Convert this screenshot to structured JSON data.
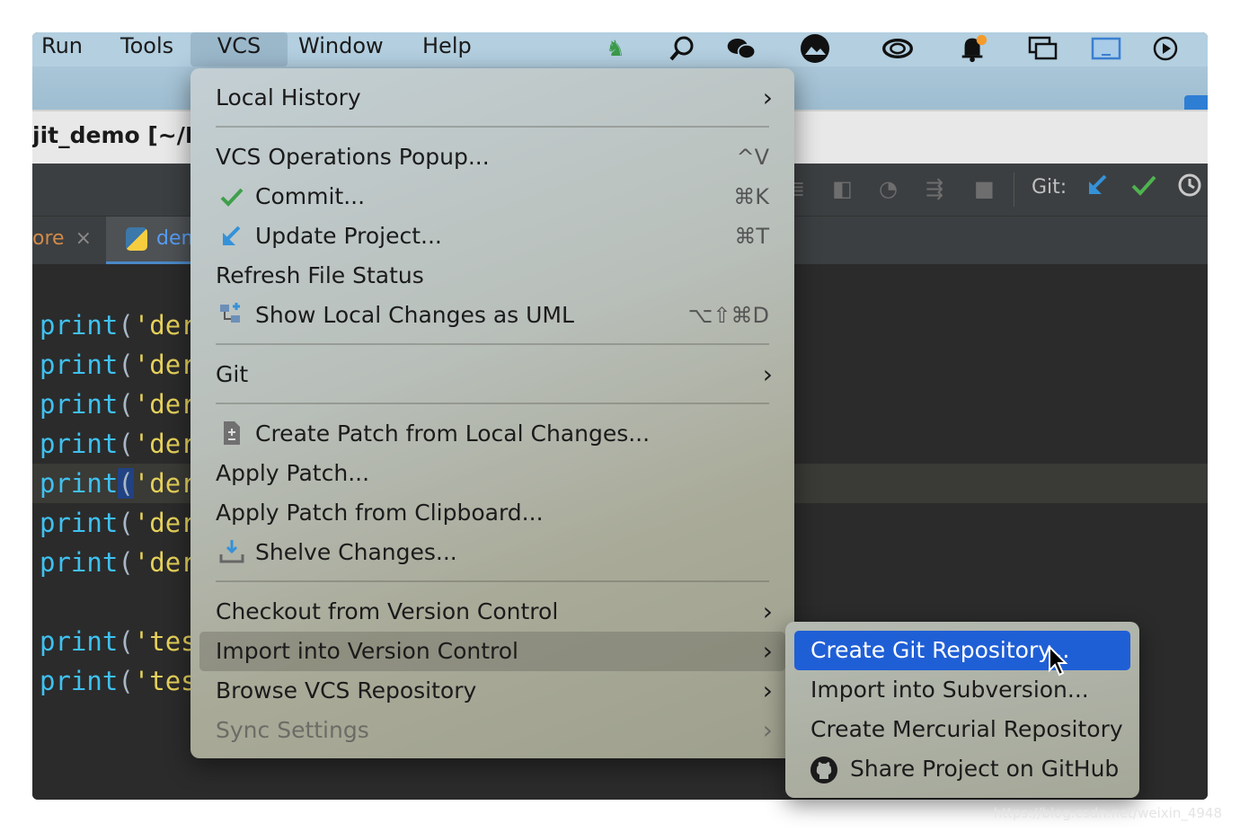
{
  "menubar": {
    "items": [
      "Run",
      "Tools",
      "VCS",
      "Window",
      "Help"
    ],
    "active": "VCS"
  },
  "title": "jit_demo [~/Py",
  "toolbar": {
    "git_label": "Git:"
  },
  "tabs": {
    "first": "ore",
    "close_glyph": "×",
    "second": "dem"
  },
  "editor": {
    "lines": [
      {
        "fn": "print",
        "open": "(",
        "str": "'der"
      },
      {
        "fn": "print",
        "open": "(",
        "str": "'der"
      },
      {
        "fn": "print",
        "open": "(",
        "str": "'der"
      },
      {
        "fn": "print",
        "open": "(",
        "str": "'der"
      },
      {
        "fn": "print",
        "open": "(",
        "str": "'der"
      },
      {
        "fn": "print",
        "open": "(",
        "str": "'der"
      },
      {
        "fn": "print",
        "open": "(",
        "str": "'der"
      },
      {
        "fn": "print",
        "open": "(",
        "str": "'tes"
      },
      {
        "fn": "print",
        "open": "(",
        "str": "'tes"
      }
    ]
  },
  "vcs_menu": {
    "local_history": "Local History",
    "vcs_operations_popup": "VCS Operations Popup...",
    "vcs_operations_popup_shortcut": "^V",
    "commit": "Commit...",
    "commit_shortcut": "⌘K",
    "update_project": "Update Project...",
    "update_project_shortcut": "⌘T",
    "refresh_file_status": "Refresh File Status",
    "show_local_changes_uml": "Show Local Changes as UML",
    "show_local_changes_uml_shortcut": "⌥⇧⌘D",
    "git": "Git",
    "create_patch": "Create Patch from Local Changes...",
    "apply_patch": "Apply Patch...",
    "apply_patch_clipboard": "Apply Patch from Clipboard...",
    "shelve_changes": "Shelve Changes...",
    "checkout_vcs": "Checkout from Version Control",
    "import_vcs": "Import into Version Control",
    "browse_vcs_repo": "Browse VCS Repository",
    "sync_settings": "Sync Settings"
  },
  "submenu": {
    "create_git_repo": "Create Git Repository...",
    "import_subversion": "Import into Subversion...",
    "create_mercurial": "Create Mercurial Repository",
    "share_github": "Share Project on GitHub"
  },
  "watermark": "https://blog.csdn.net/weixin_4948"
}
